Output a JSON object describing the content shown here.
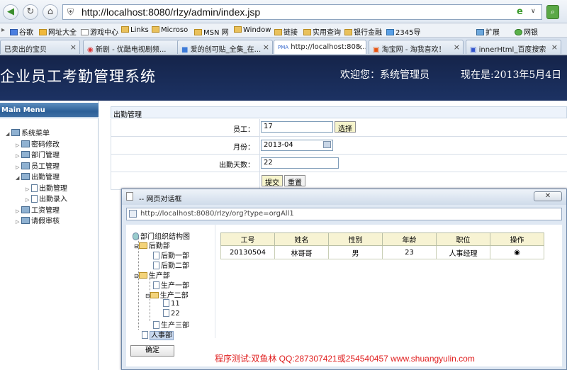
{
  "browser": {
    "url": "http://localhost:8080/rlzy/admin/index.jsp",
    "bookmarks": [
      "谷歌",
      "网址大全",
      "游戏中心",
      "Links",
      "Microso",
      "MSN 网",
      "Window",
      "链接",
      "实用查询",
      "银行金融",
      "2345导"
    ],
    "toolbar_right": [
      "扩展",
      "网银"
    ],
    "tabs": [
      {
        "label": "已卖出的宝贝"
      },
      {
        "label": "新剧 - 优酷电视剧频..."
      },
      {
        "label": "爱的创可贴_全集_在..."
      },
      {
        "label": "http://localhost:808..."
      },
      {
        "label": "淘宝网 - 淘我喜欢！"
      },
      {
        "label": "innerHtml_百度搜索"
      }
    ],
    "tab_badge": "PMA"
  },
  "header": {
    "system_name": "企业员工考勤管理系统",
    "welcome": "欢迎您：系统管理员",
    "datetime": "现在是:2013年5月4日"
  },
  "sidebar": {
    "title": "Main Menu",
    "root": "系统菜单",
    "items": [
      "密码修改",
      "部门管理",
      "员工管理",
      "出勤管理",
      "工资管理",
      "请假审核"
    ],
    "sub_items": [
      "出勤管理",
      "出勤录入"
    ]
  },
  "form": {
    "title": "出勤管理",
    "employee_label": "员工：",
    "employee_value": "17",
    "select_button": "选择",
    "month_label": "月份：",
    "month_value": "2013-04",
    "days_label": "出勤天数：",
    "days_value": "22",
    "submit_button": "提交",
    "reset_button": "重置"
  },
  "dialog": {
    "title": "-- 网页对话框",
    "url": "http://localhost:8080/rlzy/org?type=orgAll1",
    "tree": {
      "root": "部门组织结构图",
      "nodes": [
        "后勤部",
        "后勤一部",
        "后勤二部",
        "生产部",
        "生产一部",
        "生产二部",
        "11",
        "22",
        "生产三部",
        "人事部"
      ]
    },
    "table": {
      "headers": [
        "工号",
        "姓名",
        "性别",
        "年龄",
        "职位",
        "操作"
      ],
      "rows": [
        [
          "20130504",
          "林哥哥",
          "男",
          "23",
          "人事经理",
          "◉"
        ]
      ]
    },
    "ok_button": "确定",
    "watermark": "程序测试:双鱼林 QQ:287307421或254540457 www.shuangyulin.com"
  }
}
